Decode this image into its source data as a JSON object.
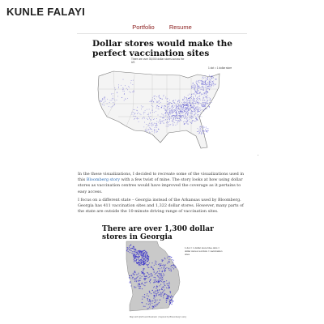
{
  "site": {
    "title": "KUNLE FALAYI"
  },
  "nav": {
    "items": [
      {
        "label": "Portfolio"
      },
      {
        "label": "Resume"
      }
    ]
  },
  "figure1": {
    "title": "Dollar stores would make the perfect vaccination sites",
    "subtitle": "There are over 35,000 dollar stores across the US",
    "legend": "1 dot = 1 dollar store"
  },
  "article": {
    "p1": {
      "before": "In the these visualizations, I decided to recreate some of the visualizations used in this",
      "link": "Bloomberg story",
      "after": "with a few twist of mine. The story looks at how using dollar stores as vaccination centres would have improved the coverage as it pertains to easy access."
    },
    "p2": "I focus on a different state – Georgia instead of the Arkansas used by Bloomberg. Georgia has 411 vaccination sites and 1,322 dollar stores. However, many parts of the state are outside the 10-minute driving range of vaccination sites."
  },
  "figure2": {
    "title": "There are over 1,300 dollar stores in Georgia",
    "legend": "1 dot = 1 dollar store   blue dots = dollar stores   red dots = vaccination sites",
    "source": "Map with QGIS and Illustrator | Inspired by Bloomberg's story"
  },
  "colors": {
    "accent": "#8a1c1c",
    "dots": "#3b34c9",
    "map_fill": "#f4f4f4",
    "ga_fill": "#c9c9c9"
  }
}
